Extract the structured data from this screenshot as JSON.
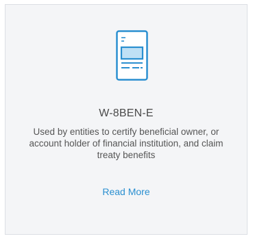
{
  "card": {
    "icon": "document-form-icon",
    "title": "W-8BEN-E",
    "description": "Used by entities to certify beneficial owner, or account holder of financial institution, and claim treaty benefits",
    "link_label": "Read More"
  },
  "colors": {
    "accent": "#2a8fd0",
    "card_background": "#f4f5f7",
    "text": "#555555"
  }
}
